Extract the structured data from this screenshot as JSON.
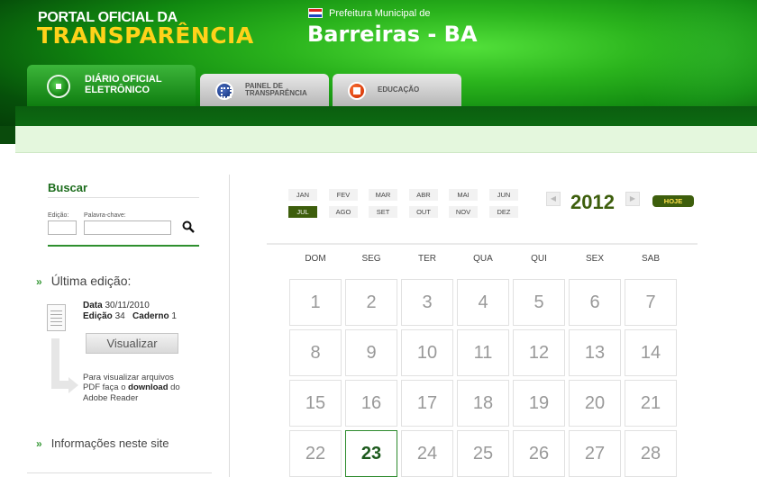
{
  "header": {
    "portal_line1": "PORTAL OFICIAL DA",
    "portal_line2": "TRANSPARÊNCIA",
    "prefeitura_label": "Prefeitura Municipal de",
    "city": "Barreiras - BA"
  },
  "tabs": [
    {
      "line1": "DIÁRIO OFICIAL",
      "line2": "ELETRÔNICO",
      "active": true
    },
    {
      "line1": "PAINEL DE",
      "line2": "TRANSPARÊNCIA",
      "active": false
    },
    {
      "line1": "EDUCAÇÃO",
      "line2": "",
      "active": false
    }
  ],
  "search": {
    "title": "Buscar",
    "edicao_label": "Edição:",
    "palavra_label": "Palavra-chave:",
    "edicao_value": "",
    "palavra_value": ""
  },
  "ultima": {
    "title": "Última edição:",
    "data_label": "Data",
    "data_value": "30/11/2010",
    "edicao_label": "Edição",
    "edicao_value": "34",
    "caderno_label": "Caderno",
    "caderno_value": "1",
    "button": "Visualizar",
    "pdf_text_1": "Para visualizar arquivos",
    "pdf_text_2a": "PDF faça o ",
    "pdf_text_2b": "download",
    "pdf_text_2c": " do",
    "pdf_text_3": "Adobe Reader"
  },
  "info": {
    "title": "Informações neste site"
  },
  "calendar": {
    "months_row1": [
      "JAN",
      "FEV",
      "MAR",
      "ABR",
      "MAI",
      "JUN"
    ],
    "months_row2": [
      "JUL",
      "AGO",
      "SET",
      "OUT",
      "NOV",
      "DEZ"
    ],
    "selected_month": "JUL",
    "year": "2012",
    "prev_arrow": "◀",
    "next_arrow": "▶",
    "hoje": "HOJE",
    "weekdays": [
      "DOM",
      "SEG",
      "TER",
      "QUA",
      "QUI",
      "SEX",
      "SAB"
    ],
    "weeks": [
      [
        "1",
        "2",
        "3",
        "4",
        "5",
        "6",
        "7"
      ],
      [
        "8",
        "9",
        "10",
        "11",
        "12",
        "13",
        "14"
      ],
      [
        "15",
        "16",
        "17",
        "18",
        "19",
        "20",
        "21"
      ],
      [
        "22",
        "23",
        "24",
        "25",
        "26",
        "27",
        "28"
      ]
    ],
    "today": "23"
  },
  "colors": {
    "brand_green": "#3d5e0c",
    "accent_yellow": "#ffd21a"
  }
}
